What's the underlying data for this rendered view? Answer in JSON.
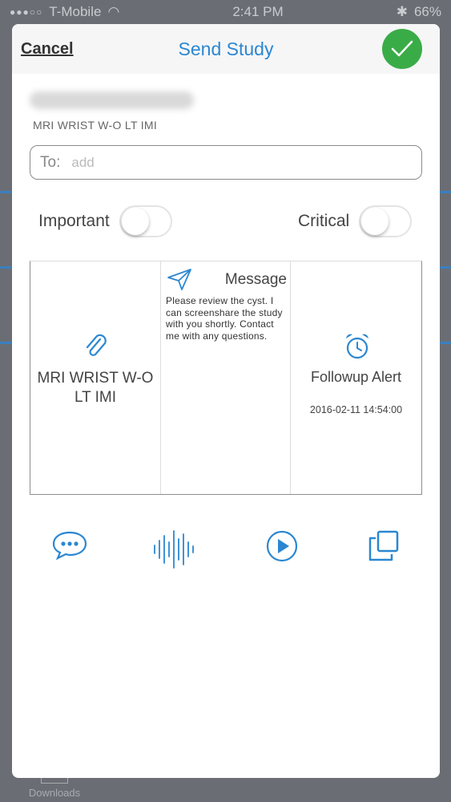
{
  "status_bar": {
    "carrier": "T-Mobile",
    "time": "2:41 PM",
    "battery": "66%"
  },
  "background": {
    "tab_label": "Downloads"
  },
  "nav": {
    "cancel_label": "Cancel",
    "title": "Send Study"
  },
  "study": {
    "description": "MRI WRIST W-O LT IMI"
  },
  "recipient": {
    "label": "To:",
    "placeholder": "add",
    "value": ""
  },
  "flags": {
    "important_label": "Important",
    "important_on": false,
    "critical_label": "Critical",
    "critical_on": false
  },
  "panel": {
    "attachment_label": "MRI WRIST W-O LT IMI",
    "message_title": "Message",
    "message_body": "Please review the cyst. I can screenshare the study with you shortly. Contact me with any questions.",
    "alert_title": "Followup Alert",
    "alert_datetime": "2016-02-11 14:54:00"
  },
  "toolbar": {
    "items": [
      "chat-bubble-icon",
      "audio-waveform-icon",
      "play-icon",
      "duplicate-icon"
    ]
  },
  "colors": {
    "accent": "#2b87d1",
    "confirm_green": "#3aac47"
  }
}
